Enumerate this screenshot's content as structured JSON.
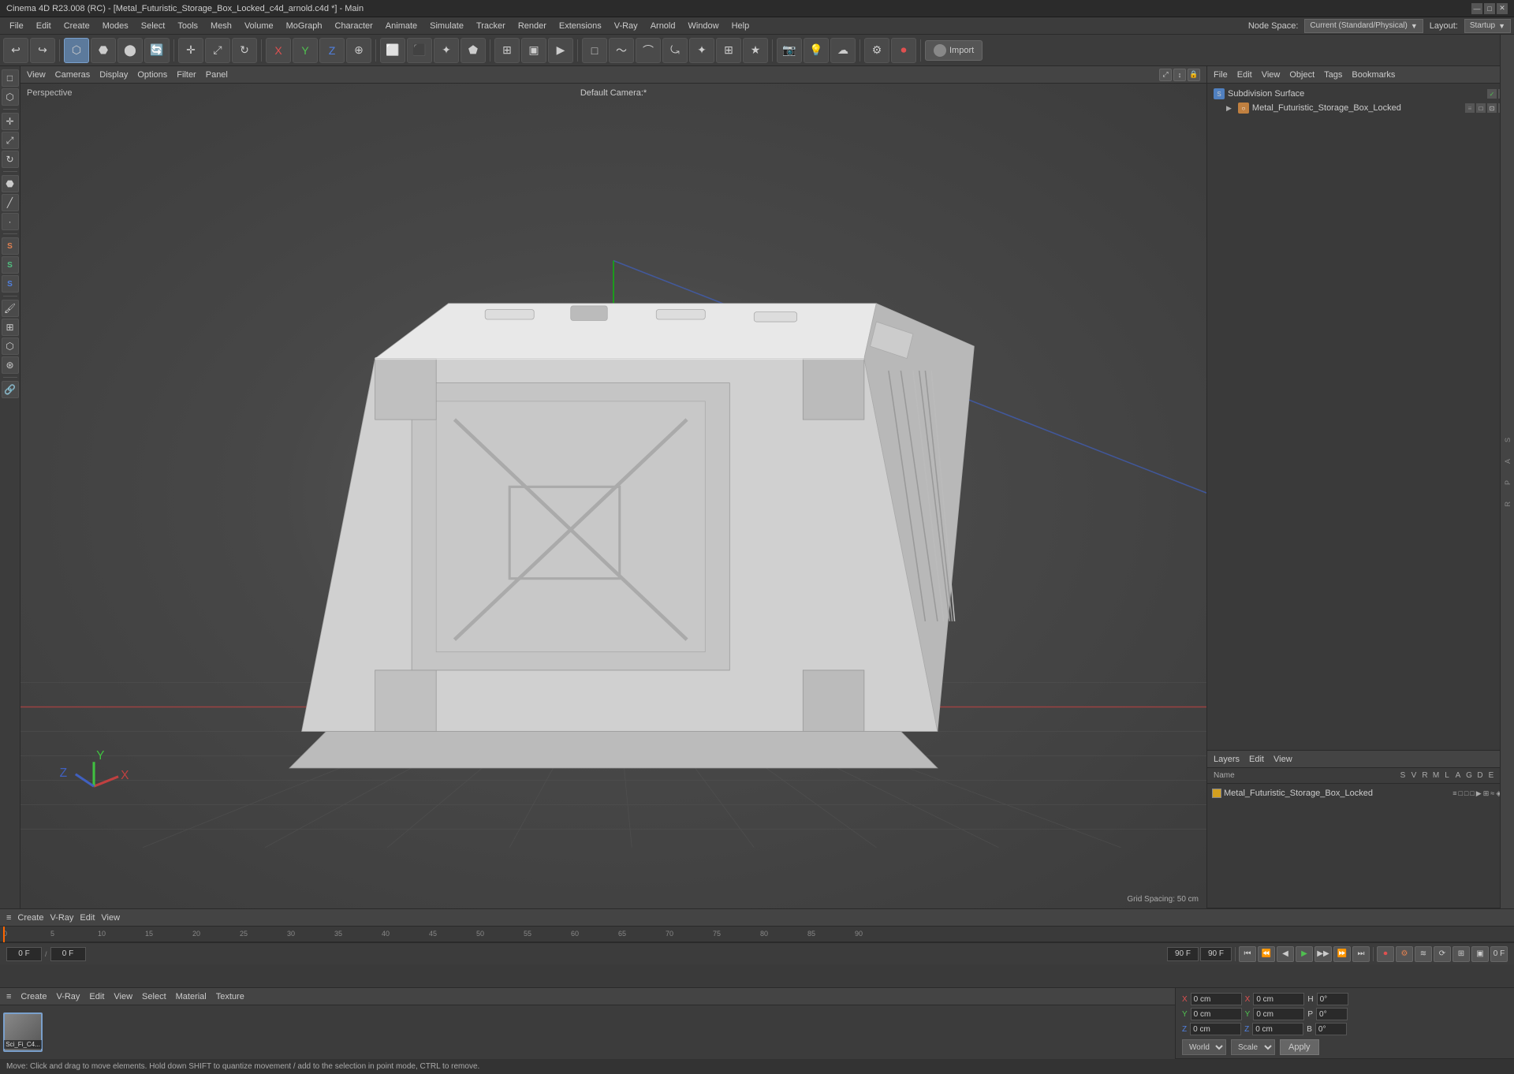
{
  "titleBar": {
    "title": "Cinema 4D R23.008 (RC) - [Metal_Futuristic_Storage_Box_Locked_c4d_arnold.c4d *] - Main",
    "minimize": "—",
    "maximize": "□",
    "close": "✕"
  },
  "menuBar": {
    "items": [
      "File",
      "Edit",
      "Create",
      "Modes",
      "Select",
      "Tools",
      "Mesh",
      "Volume",
      "MoGraph",
      "Character",
      "Animate",
      "Simulate",
      "Tracker",
      "Render",
      "Extensions",
      "V-Ray",
      "Arnold",
      "Window",
      "Help"
    ],
    "nodeSpace": "Node Space:",
    "nodeSpaceValue": "Current (Standard/Physical)",
    "layout": "Layout:",
    "layoutValue": "Startup"
  },
  "viewport": {
    "headerItems": [
      "View",
      "Cameras",
      "Display",
      "Options",
      "Filter",
      "Panel"
    ],
    "perspectiveLabel": "Perspective",
    "cameraLabel": "Default Camera:*",
    "gridSpacing": "Grid Spacing: 50 cm"
  },
  "objectManager": {
    "headerItems": [
      "Node Space:",
      "File",
      "Edit",
      "View",
      "Object",
      "Tags",
      "Bookmarks"
    ],
    "items": [
      {
        "name": "Subdivision Surface",
        "type": "subdivision"
      },
      {
        "name": "Metal_Futuristic_Storage_Box_Locked",
        "type": "object"
      }
    ]
  },
  "layersPanel": {
    "title": "Layers",
    "headerItems": [
      "Layers",
      "Edit",
      "View"
    ],
    "columnHeaders": "Name                                          S  V  R  M  L  A  G  D  E  X",
    "items": [
      {
        "name": "Metal_Futuristic_Storage_Box_Locked",
        "color": "#d4a020"
      }
    ]
  },
  "toolbar": {
    "importLabel": "Import",
    "tools": [
      "undo",
      "redo",
      "live",
      "move",
      "scale",
      "rotate",
      "select-live",
      "x-axis",
      "y-axis",
      "z-axis",
      "coord-sys",
      "snap",
      "render-region",
      "render-view",
      "render",
      "tex-preview",
      "material-editor",
      "anim-rec",
      "anim-auto-key",
      "timeline",
      "curve-editor",
      "motion-clip",
      "drive",
      "select-object",
      "select-poly",
      "select-edge",
      "select-point",
      "paint",
      "sculpt-grab",
      "sculpt-smooth",
      "character-obj",
      "joint",
      "set-driver",
      "set-driven",
      "spline-wrap",
      "mograph",
      "effector",
      "deformer",
      "camera-obj",
      "light-obj",
      "sky"
    ]
  },
  "timeline": {
    "headerItems": [
      "≡",
      "Create",
      "V-Ray",
      "Edit",
      "View"
    ],
    "currentFrame": "0 F",
    "startFrame": "0 F",
    "endFrame": "90 F",
    "fpsValue": "90 F",
    "frameField1": "0 F",
    "frameField2": "0 F",
    "rulerMarks": [
      0,
      5,
      10,
      15,
      20,
      25,
      30,
      35,
      40,
      45,
      50,
      55,
      60,
      65,
      70,
      75,
      80,
      85,
      90
    ],
    "playbackButtons": [
      "⏮",
      "⏪",
      "⏴",
      "▶",
      "⏵",
      "⏩",
      "⏭"
    ],
    "extraButtons": [
      "rec",
      "auto",
      "anim",
      "mode",
      "more"
    ]
  },
  "materialBar": {
    "headerItems": [
      "≡",
      "Create",
      "V-Ray",
      "Edit",
      "View",
      "Select",
      "Material",
      "Texture"
    ],
    "materials": [
      {
        "name": "Sci_Fi_C4...",
        "thumb": "metal"
      }
    ]
  },
  "coordinates": {
    "xPos": "0 cm",
    "yPos": "0 cm",
    "zPos": "0 cm",
    "xSize": "0 cm",
    "ySize": "0 cm",
    "zSize": "0 cm",
    "hRot": "0°",
    "pRot": "0°",
    "bRot": "0°",
    "worldLabel": "World",
    "scaleLabel": "Scale",
    "applyLabel": "Apply"
  },
  "statusBar": {
    "text": "Move: Click and drag to move elements. Hold down SHIFT to quantize movement / add to the selection in point mode, CTRL to remove."
  }
}
